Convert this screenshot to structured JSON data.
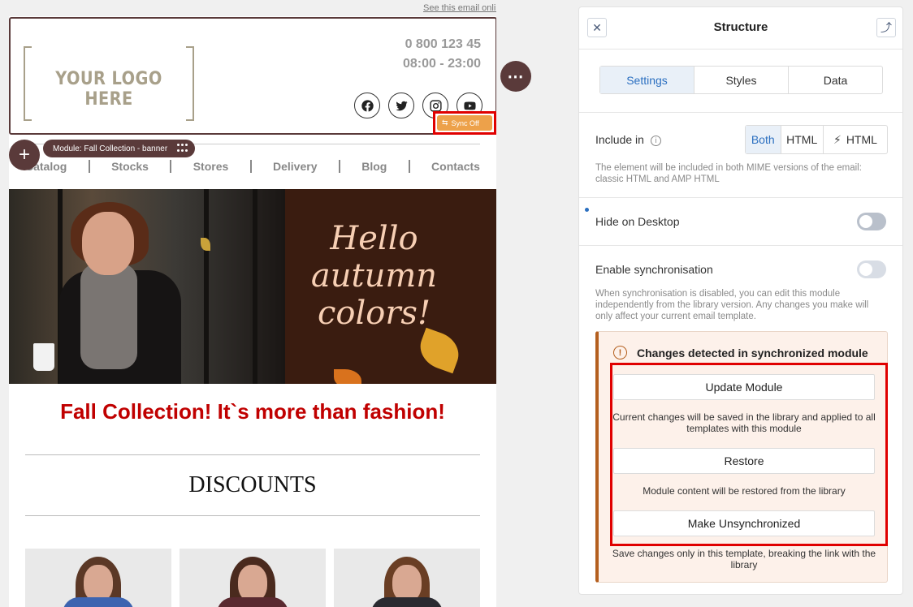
{
  "email": {
    "see_online": "See this email online",
    "logo_text": "YOUR LOGO HERE",
    "phone": "0 800 123 45",
    "hours": "08:00 - 23:00",
    "sync_badge": "Sync Off",
    "module_chip": "Module: Fall Collection - banner",
    "nav": [
      "Catalog",
      "Stocks",
      "Stores",
      "Delivery",
      "Blog",
      "Contacts"
    ],
    "banner_text": [
      "Hello",
      "autumn",
      "colors!"
    ],
    "headline": "Fall Collection! It`s more than fashion!",
    "section_title": "DISCOUNTS",
    "socials": [
      "facebook-icon",
      "twitter-icon",
      "instagram-icon",
      "youtube-icon"
    ]
  },
  "panel": {
    "title": "Structure",
    "tabs": [
      "Settings",
      "Styles",
      "Data"
    ],
    "active_tab": "Settings",
    "include_in": {
      "label": "Include in",
      "options": [
        "Both",
        "HTML",
        "HTML"
      ],
      "selected": "Both",
      "hint": "The element will be included in both MIME versions of the email: classic HTML and AMP HTML"
    },
    "hide_desktop": {
      "label": "Hide on Desktop",
      "enabled": false
    },
    "sync": {
      "label": "Enable synchronisation",
      "enabled": false,
      "hint": "When synchronisation is disabled, you can edit this module independently from the library version. Any changes you make will only affect your current email template."
    },
    "changes": {
      "title": "Changes detected in synchronized module",
      "update_label": "Update Module",
      "update_hint": "Current changes will be saved in the library and applied to all templates with this module",
      "restore_label": "Restore",
      "restore_hint": "Module content will be restored from the library",
      "unsync_label": "Make Unsynchronized",
      "unsync_hint": "Save changes only in this template, breaking the link with the library"
    }
  },
  "colors": {
    "brand_dark": "#5a3a3a",
    "accent_blue": "#2b6fc0",
    "headline_red": "#c00000",
    "sync_orange": "#eda14a",
    "warning_border": "#b45f1e"
  }
}
